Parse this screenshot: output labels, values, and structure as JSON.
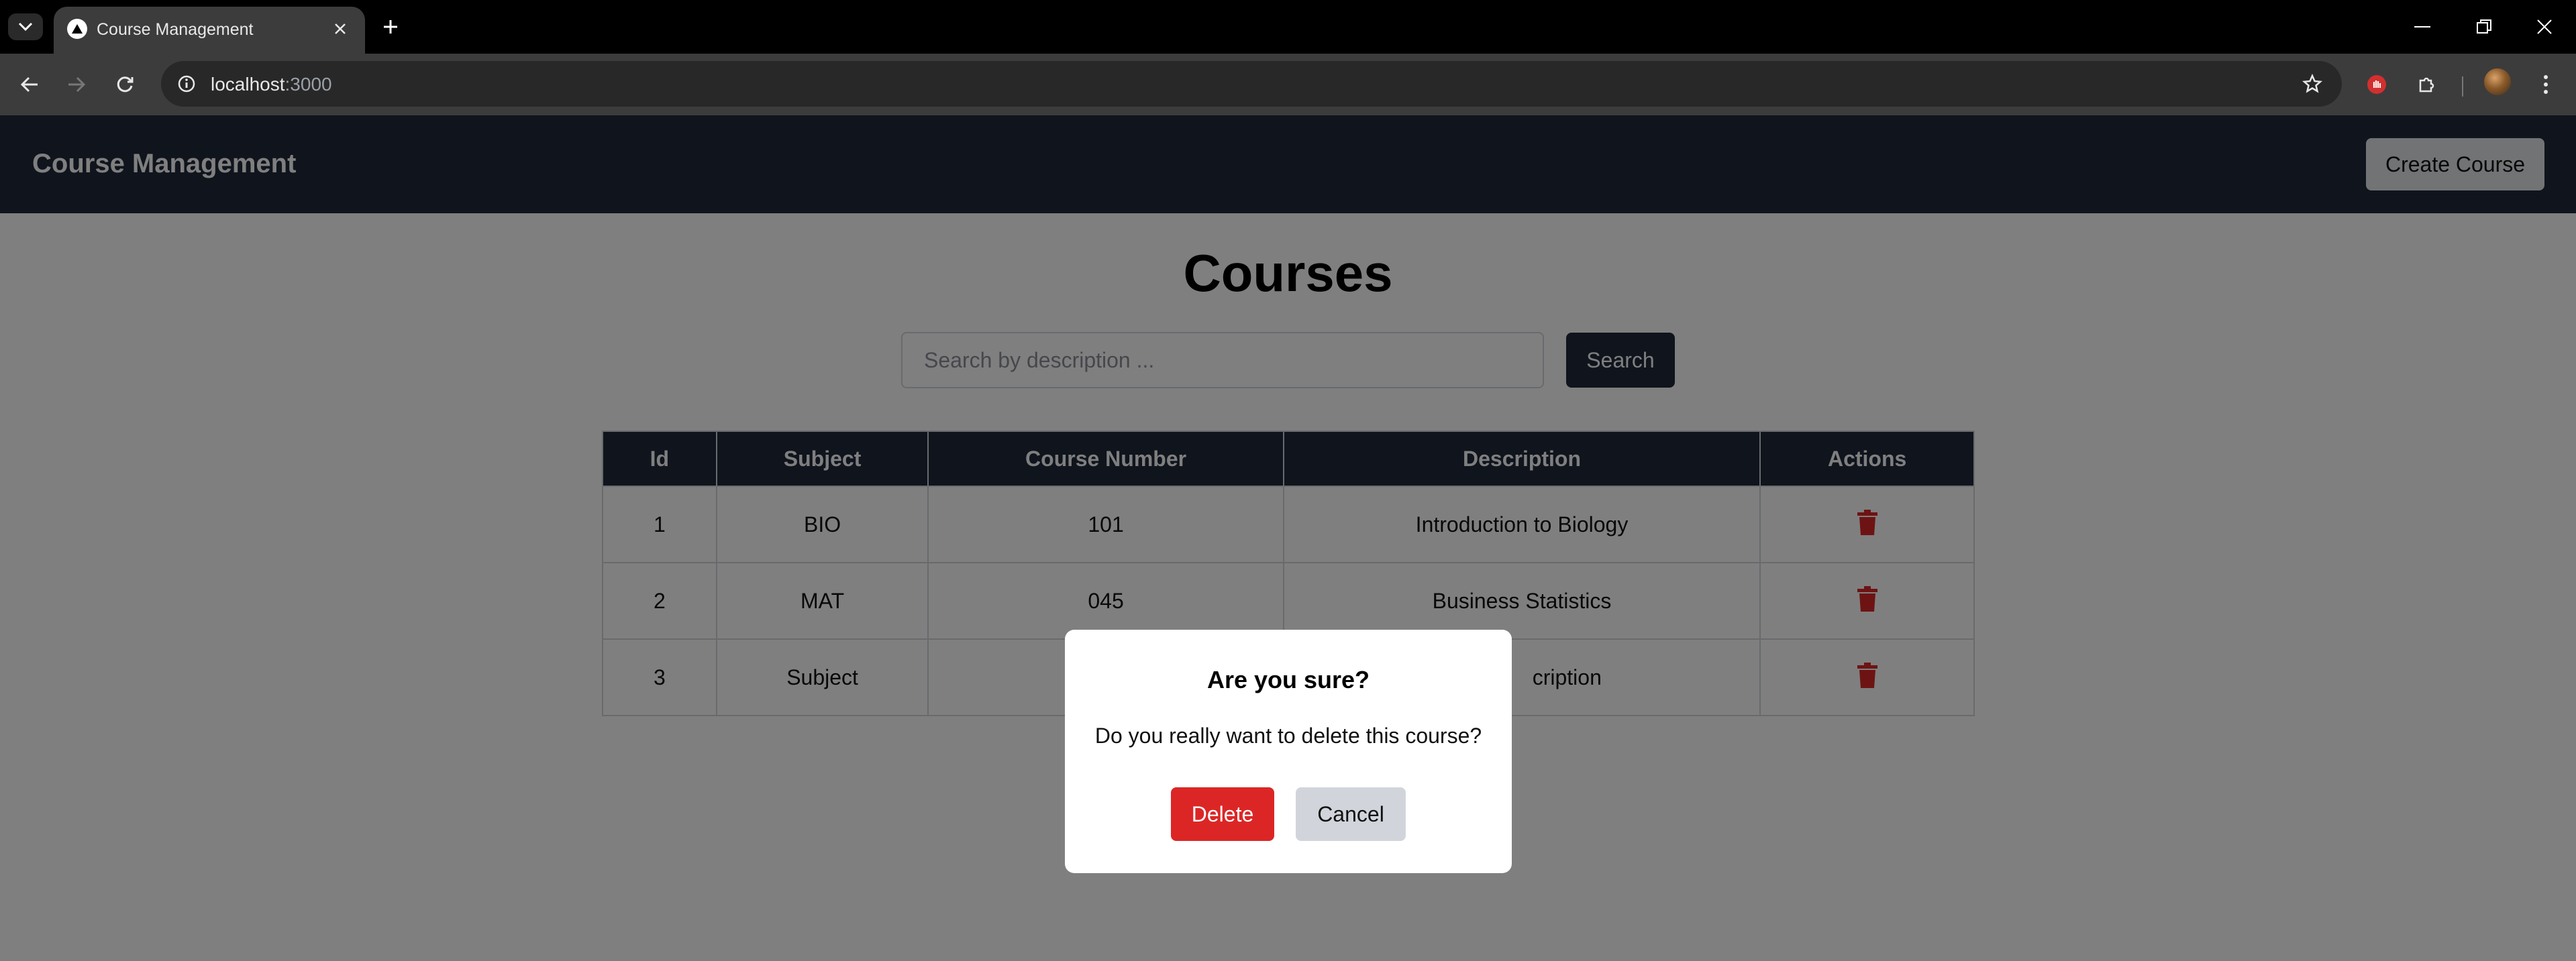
{
  "browser": {
    "tab_title": "Course Management",
    "url_host": "localhost",
    "url_port": ":3000",
    "icons": {
      "tab_list": "chevron-down-icon",
      "favicon": "triangle-logo-icon",
      "tab_close": "close-icon",
      "new_tab": "plus-icon",
      "back": "back-arrow-icon",
      "forward": "forward-arrow-icon",
      "reload": "reload-icon",
      "site_info": "info-icon",
      "bookmark": "star-icon",
      "extension1": "hand-stop-icon",
      "extensions": "puzzle-icon",
      "menu": "kebab-menu-icon"
    }
  },
  "header": {
    "title": "Course Management",
    "create_label": "Create Course"
  },
  "main": {
    "heading": "Courses",
    "search_placeholder": "Search by description ...",
    "search_label": "Search",
    "table": {
      "columns": [
        "Id",
        "Subject",
        "Course Number",
        "Description",
        "Actions"
      ],
      "rows": [
        {
          "id": "1",
          "subject": "BIO",
          "number": "101",
          "description": "Introduction to Biology"
        },
        {
          "id": "2",
          "subject": "MAT",
          "number": "045",
          "description": "Business Statistics"
        },
        {
          "id": "3",
          "subject": "Subject",
          "number": "",
          "description": "cription"
        }
      ]
    }
  },
  "modal": {
    "title": "Are you sure?",
    "message": "Do you really want to delete this course?",
    "delete_label": "Delete",
    "cancel_label": "Cancel"
  },
  "colors": {
    "header_bg": "#1e293b",
    "delete_red": "#dc2626",
    "cancel_gray": "#d1d5db"
  }
}
